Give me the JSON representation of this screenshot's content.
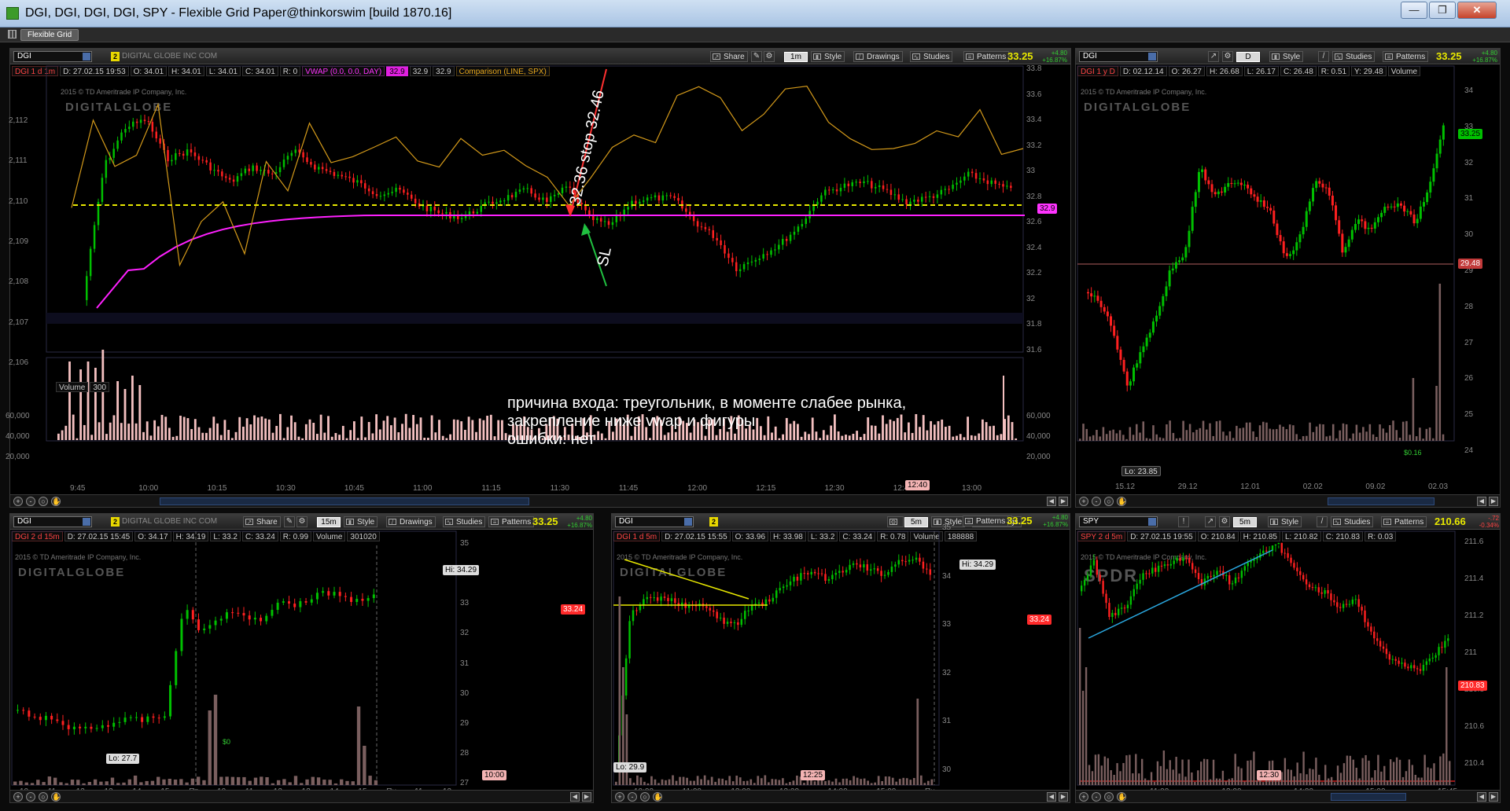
{
  "window": {
    "title": "DGI, DGI, DGI, DGI, SPY - Flexible Grid Paper@thinkorswim [build 1870.16]",
    "buttons": {
      "min": "—",
      "max": "❐",
      "close": "✕"
    }
  },
  "menubar": {
    "grid_tab": "Flexible Grid"
  },
  "toolbar_labels": {
    "share": "Share",
    "style": "Style",
    "drawings": "Drawings",
    "studies": "Studies",
    "patterns": "Patterns"
  },
  "colors": {
    "up": "#00c000",
    "down": "#ff2020",
    "vwap": "#ff20ff",
    "compare": "#d49a1a",
    "dashed": "#e8e800",
    "volume": "#f4c0c0",
    "volume_bar": "#7a5f5f"
  },
  "panels": {
    "main": {
      "symbol": "DGI",
      "link": "2",
      "company": "DIGITAL GLOBE INC COM",
      "agg": "1m",
      "price": "33.25",
      "chg1": "+4.80",
      "chg2": "+16.87%",
      "info": [
        "DGI 1 d 1m",
        "D: 27.02.15 19:53",
        "O: 34.01",
        "H: 34.01",
        "L: 34.01",
        "C: 34.01",
        "R: 0",
        "VWAP (0.0, 0.0, DAY)",
        "32.9",
        "32.9",
        "32.9",
        "Comparison (LINE, SPX)"
      ],
      "copyright": "2015 © TD Ameritrade IP Company, Inc.",
      "watermark": "DIGITALGLOBE",
      "left_axis": [
        "2,112",
        "2,111",
        "2,110",
        "2,109",
        "2,108",
        "2,107",
        "2,106"
      ],
      "right_axis": [
        "33.8",
        "33.6",
        "33.4",
        "33.2",
        "33",
        "32.8",
        "32.6",
        "32.4",
        "32.2",
        "32",
        "31.8",
        "31.6"
      ],
      "price_tag": "32.9",
      "vol_label": "Volume",
      "vol_value": "300",
      "vol_axis": [
        "60,000",
        "40,000",
        "20,000"
      ],
      "time_axis": [
        "9:45",
        "10:00",
        "10:15",
        "10:30",
        "10:45",
        "11:00",
        "11:15",
        "11:30",
        "11:45",
        "12:00",
        "12:15",
        "12:30",
        "12:45",
        "13:00"
      ],
      "time_tag": "12:40",
      "annot_stop": "32.36 stop 32.46",
      "annot_sl": "SL",
      "note": [
        "причина входа: треугольник, в моменте слабее рынка,",
        "закрепление ниже vwap и фигуры",
        "ошибки: нет"
      ]
    },
    "daily": {
      "symbol": "DGI",
      "agg": "D",
      "price": "33.25",
      "chg1": "+4.80",
      "chg2": "+16.87%",
      "info": [
        "DGI 1 y D",
        "D: 02.12.14",
        "O: 26.27",
        "H: 26.68",
        "L: 26.17",
        "C: 26.48",
        "R: 0.51",
        "Y: 29.48",
        "Volume"
      ],
      "copyright": "2015 © TD Ameritrade IP Company, Inc.",
      "watermark": "DIGITALGLOBE",
      "right_axis": [
        "34",
        "33",
        "32",
        "31",
        "30",
        "29",
        "28",
        "27",
        "26",
        "25",
        "24"
      ],
      "tags": [
        "33.25",
        "29.48"
      ],
      "lo": "Lo: 23.85",
      "div": "$0.16",
      "time_axis": [
        "15.12",
        "29.12",
        "12.01",
        "02.02",
        "09.02",
        "02.03"
      ]
    },
    "p15": {
      "symbol": "DGI",
      "link": "2",
      "company": "DIGITAL GLOBE INC COM",
      "agg": "15m",
      "price": "33.25",
      "chg1": "+4.80",
      "chg2": "+16.87%",
      "info": [
        "DGI 2 d 15m",
        "D: 27.02.15 15:45",
        "O: 34.17",
        "H: 34.19",
        "L: 33.2",
        "C: 33.24",
        "R: 0.99",
        "Volume",
        "301020"
      ],
      "copyright": "2015 © TD Ameritrade IP Company, Inc.",
      "watermark": "DIGITALGLOBE",
      "right_axis": [
        "35",
        "34",
        "33",
        "32",
        "31",
        "30",
        "29",
        "28",
        "27"
      ],
      "tag": "33.24",
      "hi": "Hi: 34.29",
      "lo": "Lo: 27.7",
      "div": "$0",
      "time_axis": [
        "10",
        "11",
        "12",
        "13",
        "14",
        "15",
        "Пт",
        "10",
        "11",
        "12",
        "13",
        "14",
        "15",
        "Пн",
        "11",
        "12"
      ],
      "time_tag": "10:00"
    },
    "p5": {
      "symbol": "DGI",
      "link": "2",
      "agg": "5m",
      "price": "33.25",
      "chg1": "+4.80",
      "chg2": "+16.87%",
      "info": [
        "DGI 1 d 5m",
        "D: 27.02.15 15:55",
        "O: 33.96",
        "H: 33.98",
        "L: 33.2",
        "C: 33.24",
        "R: 0.78",
        "Volume",
        "188888"
      ],
      "copyright": "2015 © TD Ameritrade IP Company, Inc.",
      "watermark": "DIGITALGLOBE",
      "right_axis": [
        "35",
        "34",
        "33",
        "32",
        "31",
        "30"
      ],
      "tag": "33.24",
      "hi": "Hi: 34.29",
      "lo": "Lo: 29.9",
      "time_axis": [
        "10:00",
        "11:00",
        "12:00",
        "13:00",
        "14:00",
        "15:00",
        "Пн"
      ],
      "time_tag": "12:25"
    },
    "spy": {
      "symbol": "SPY",
      "agg": "5m",
      "price": "210.66",
      "chg1": "-.72",
      "chg2": "-0.34%",
      "info": [
        "SPY 2 d 5m",
        "D: 27.02.15 19:55",
        "O: 210.84",
        "H: 210.85",
        "L: 210.82",
        "C: 210.83",
        "R: 0.03"
      ],
      "copyright": "2015 © TD Ameritrade IP Company, Inc.",
      "watermark": "SPDR",
      "right_axis": [
        "211.6",
        "211.4",
        "211.2",
        "211",
        "210.8",
        "210.6",
        "210.4"
      ],
      "tag": "210.83",
      "time_axis": [
        "11:00",
        "12:00",
        "14:00",
        "15:00",
        "15:45"
      ],
      "time_tag": "12:30"
    }
  }
}
